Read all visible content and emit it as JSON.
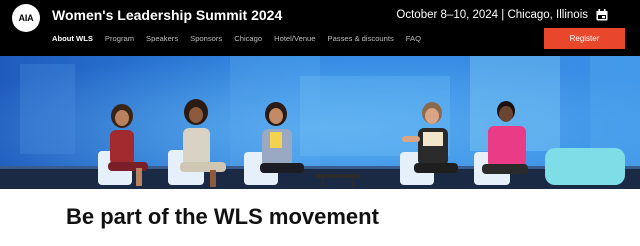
{
  "header": {
    "logo_text": "AIA",
    "title": "Women's Leadership Summit 2024",
    "event_meta": "October 8–10, 2024 | Chicago, Illinois",
    "calendar_icon": "calendar-icon",
    "register_label": "Register",
    "register_color": "#e8472b"
  },
  "nav": {
    "items": [
      "About WLS",
      "Program",
      "Speakers",
      "Sponsors",
      "Chicago",
      "Hotel/Venue",
      "Passes & discounts",
      "FAQ"
    ]
  },
  "main": {
    "headline": "Be part of the WLS movement"
  }
}
